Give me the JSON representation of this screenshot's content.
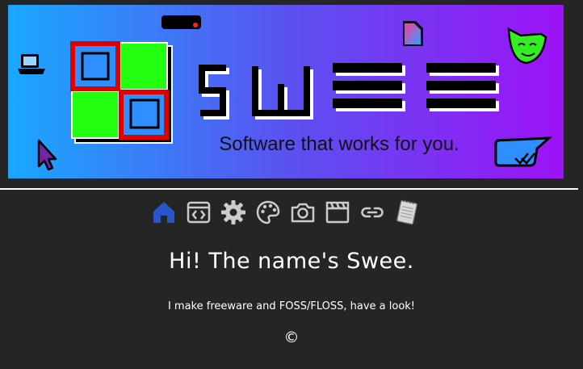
{
  "banner": {
    "logo_text": "SWEE",
    "tagline": "Software that works for you."
  },
  "nav": {
    "items": [
      {
        "name": "home-icon",
        "active": true
      },
      {
        "name": "code-window-icon",
        "active": false
      },
      {
        "name": "gear-icon",
        "active": false
      },
      {
        "name": "palette-icon",
        "active": false
      },
      {
        "name": "camera-icon",
        "active": false
      },
      {
        "name": "clapperboard-icon",
        "active": false
      },
      {
        "name": "link-icon",
        "active": false
      },
      {
        "name": "notepad-icon",
        "active": false
      }
    ]
  },
  "main": {
    "heading": "Hi! The name's Swee.",
    "subtitle": "I make freeware and FOSS/FLOSS, have a look!",
    "copyright_symbol": "©"
  },
  "colors": {
    "background": "#252525",
    "accent_active": "#2a55c9",
    "icon_inactive": "#cccccc",
    "banner_left": "#1aa8ff",
    "banner_right": "#9d12f6"
  }
}
